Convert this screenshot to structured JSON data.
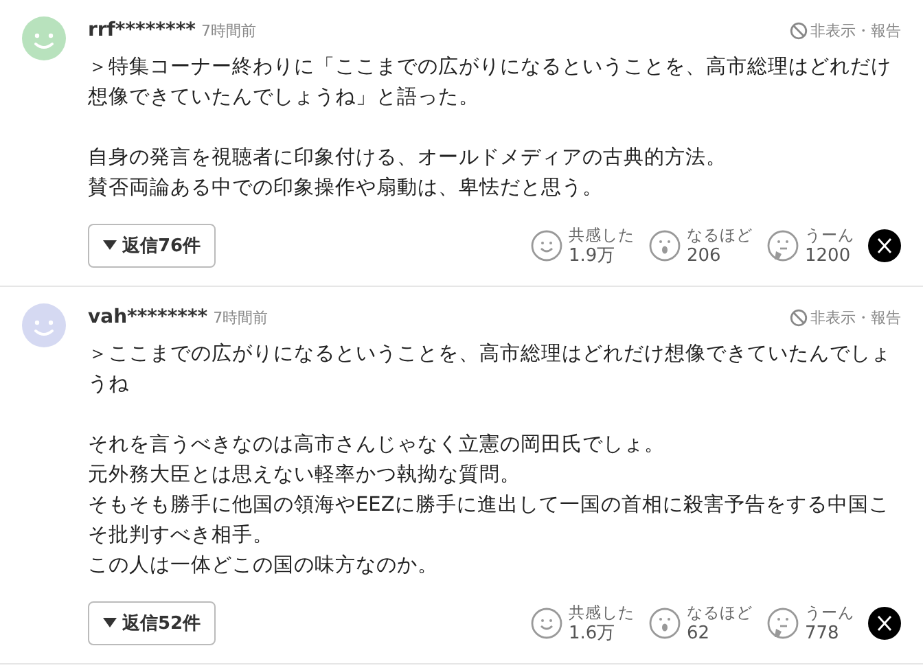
{
  "comments": [
    {
      "user": "rrf********",
      "time": "7時間前",
      "color": "#b8e2bd",
      "hide_report": "非表示・報告",
      "paragraphs": [
        [
          "＞特集コーナー終わりに「ここまでの広がりになるということを、高市総理はどれだけ",
          "想像できていたんでしょうね」と語った。"
        ],
        [
          "自身の発言を視聴者に印象付ける、オールドメディアの古典的方法。",
          "賛否両論ある中での印象操作や扇動は、卑怯だと思う。"
        ]
      ],
      "replies": "返信76件",
      "reactions": [
        {
          "kind": "smile",
          "label": "共感した",
          "count": "1.9万"
        },
        {
          "kind": "surprise",
          "label": "なるほど",
          "count": "206"
        },
        {
          "kind": "think",
          "label": "うーん",
          "count": "1200"
        }
      ]
    },
    {
      "user": "vah********",
      "time": "7時間前",
      "color": "#d5d9f2",
      "hide_report": "非表示・報告",
      "paragraphs": [
        [
          "＞ここまでの広がりになるということを、高市総理はどれだけ想像できていたんでしょ",
          "うね"
        ],
        [
          "それを言うべきなのは高市さんじゃなく立憲の岡田氏でしょ。",
          "元外務大臣とは思えない軽率かつ執拗な質問。",
          "そもそも勝手に他国の領海やEEZに勝手に進出して一国の首相に殺害予告をする中国こ",
          "そ批判すべき相手。",
          "この人は一体どこの国の味方なのか。"
        ]
      ],
      "replies": "返信52件",
      "reactions": [
        {
          "kind": "smile",
          "label": "共感した",
          "count": "1.6万"
        },
        {
          "kind": "surprise",
          "label": "なるほど",
          "count": "62"
        },
        {
          "kind": "think",
          "label": "うーん",
          "count": "778"
        }
      ]
    }
  ]
}
